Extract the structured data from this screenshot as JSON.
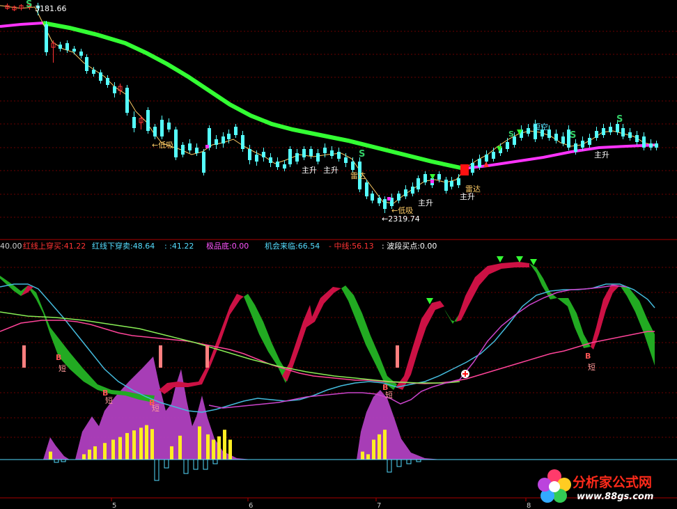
{
  "chart_data": [
    {
      "type": "candlestick",
      "panel": "price",
      "annotations": {
        "high_label": "3181.66",
        "low_label": "←2319.74",
        "main_rise_labels": [
          "主升",
          "主升",
          "主升",
          "主升"
        ],
        "radar_labels": [
          "雷达",
          "雷达"
        ],
        "low_buy_labels": [
          "←低吸",
          "←低吸"
        ],
        "short_empty_label": "短空",
        "s_marks": [
          "S",
          "S",
          "S",
          "S",
          "S"
        ]
      }
    },
    {
      "type": "line",
      "panel": "indicator",
      "title_left": "40.00",
      "legend": [
        {
          "text": "红线上穿买:41.22",
          "color": "#ff3333"
        },
        {
          "text": "红线下穿卖:48.64",
          "color": "#55ddff"
        },
        {
          "text": ":  :41.22",
          "color": "#55ddff"
        },
        {
          "text": "极品底:0.00",
          "color": "#ff55ff"
        },
        {
          "text": "机会来临:66.54",
          "color": "#55ddff"
        },
        {
          "text": "-  中线:56.13",
          "color": "#ff3333"
        },
        {
          "text": ":  波段买点:0.00",
          "color": "#ffffff"
        }
      ],
      "signal_labels": [
        "短",
        "短",
        "短",
        "短",
        "短"
      ],
      "b_marks": [
        "B",
        "B",
        "B",
        "B",
        "B"
      ],
      "x_ticks": [
        "5",
        "6",
        "7",
        "8"
      ],
      "volume_bars": [
        0.12,
        0.08,
        0.15,
        0.2,
        0.25,
        0.3,
        0.34,
        0.4,
        0.44,
        0.48,
        0.52,
        0.46,
        0.2,
        0.36,
        0.5,
        0.38,
        0.3,
        0.35,
        0.45,
        0.3,
        0.12,
        0.08,
        0.3,
        0.38,
        0.45
      ]
    }
  ],
  "watermark": {
    "title": "分析家公式网",
    "url": "www.88gs.com"
  }
}
